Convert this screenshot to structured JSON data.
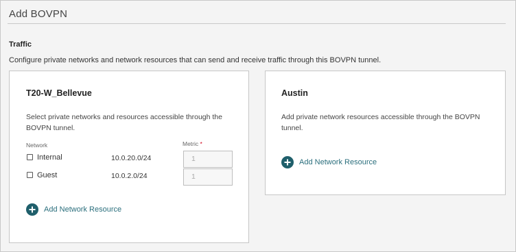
{
  "page": {
    "title": "Add BOVPN"
  },
  "traffic": {
    "heading": "Traffic",
    "description": "Configure private networks and network resources that can send and receive traffic through this BOVPN tunnel."
  },
  "local_card": {
    "title": "T20-W_Bellevue",
    "description": "Select private networks and resources accessible through the BOVPN tunnel.",
    "network_label": "Network",
    "metric_label": "Metric",
    "required_marker": "*",
    "rows": [
      {
        "name": "Internal",
        "address": "10.0.20.0/24",
        "metric": "1",
        "checked": false
      },
      {
        "name": "Guest",
        "address": "10.0.2.0/24",
        "metric": "1",
        "checked": false
      }
    ],
    "add_label": "Add Network Resource"
  },
  "remote_card": {
    "title": "Austin",
    "description": "Add private network resources accessible through the BOVPN tunnel.",
    "add_label": "Add Network Resource"
  },
  "colors": {
    "accent": "#1f5f6b",
    "link": "#2a6e7c",
    "required": "#d0021b"
  },
  "icons": {
    "add": "plus-circle-icon",
    "checkbox": "checkbox-icon"
  }
}
